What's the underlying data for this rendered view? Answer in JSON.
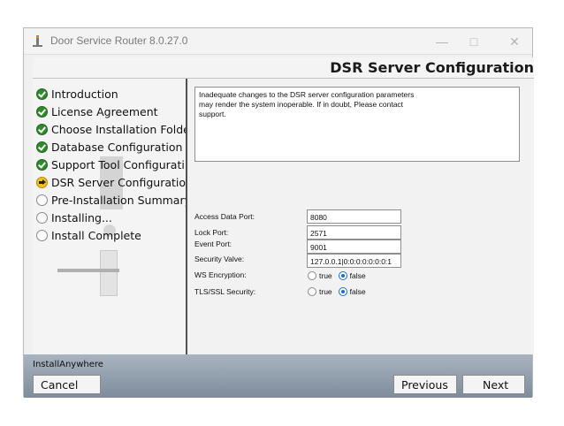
{
  "window": {
    "title": "Door Service Router 8.0.27.0",
    "controls": {
      "minimize": "—",
      "maximize": "□",
      "close": "✕"
    }
  },
  "header": {
    "title": "DSR Server Configuration"
  },
  "steps": [
    {
      "label": "Introduction",
      "state": "done"
    },
    {
      "label": "License Agreement",
      "state": "done"
    },
    {
      "label": "Choose Installation Folder",
      "state": "done"
    },
    {
      "label": "Database Configuration",
      "state": "done"
    },
    {
      "label": "Support Tool Configurati...",
      "state": "done"
    },
    {
      "label": "DSR Server Configuration",
      "state": "current"
    },
    {
      "label": "Pre-Installation Summary",
      "state": "pending"
    },
    {
      "label": "Installing...",
      "state": "pending"
    },
    {
      "label": "Install Complete",
      "state": "pending"
    }
  ],
  "notice": {
    "lines": [
      "Inadequate changes to the DSR server configuration parameters",
      "may render the system inoperable. If in doubt, Please contact",
      "support."
    ]
  },
  "fields": {
    "access_data_port": {
      "label": "Access Data Port:",
      "value": "8080"
    },
    "lock_port": {
      "label": "Lock Port:",
      "value": "2571"
    },
    "event_port": {
      "label": "Event Port:",
      "value": "9001"
    },
    "security_valve": {
      "label": "Security Valve:",
      "value": "127.0.0.1|0:0:0:0:0:0:0:1"
    },
    "ws_encryption": {
      "label": "WS Encryption:",
      "options": [
        "true",
        "false"
      ],
      "selected": "false"
    },
    "tls_ssl_security": {
      "label": "TLS/SSL Security:",
      "options": [
        "true",
        "false"
      ],
      "selected": "false"
    }
  },
  "footer": {
    "brand": "InstallAnywhere",
    "cancel_label": "Cancel",
    "previous_label": "Previous",
    "next_label": "Next"
  }
}
